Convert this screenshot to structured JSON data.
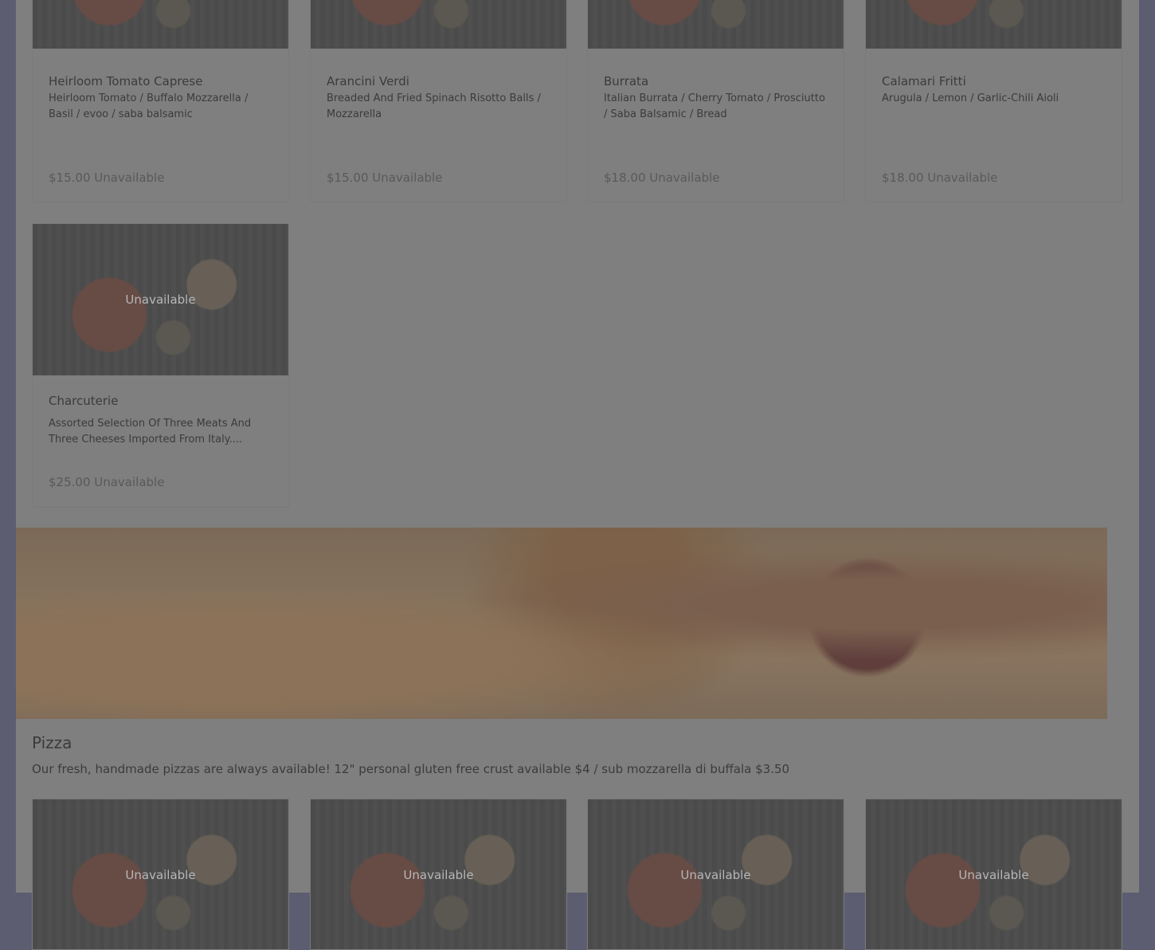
{
  "appetizers": [
    {
      "title": "Heirloom Tomato Caprese",
      "desc": "Heirloom Tomato / Buffalo Mozzarella / Basil / evoo / saba balsamic",
      "price": "$15.00 Unavailable"
    },
    {
      "title": "Arancini Verdi",
      "desc": "Breaded And Fried Spinach Risotto Balls / Mozzarella",
      "price": "$15.00 Unavailable"
    },
    {
      "title": "Burrata",
      "desc": "Italian Burrata / Cherry Tomato / Prosciutto / Saba Balsamic / Bread",
      "price": "$18.00 Unavailable"
    },
    {
      "title": "Calamari Fritti",
      "desc": "Arugula / Lemon / Garlic-Chili Aioli",
      "price": "$18.00 Unavailable"
    },
    {
      "title": "Charcuterie",
      "desc": "Assorted Selection Of Three Meats And Three Cheeses Imported From Italy....",
      "price": "$25.00 Unavailable",
      "image_label": "Unavailable"
    }
  ],
  "pizza_section": {
    "title": "Pizza",
    "desc": "Our fresh, handmade pizzas are always available! 12\" personal gluten free crust available $4 / sub mozzarella di buffala $3.50"
  },
  "pizza_cards": [
    {
      "image_label": "Unavailable"
    },
    {
      "image_label": "Unavailable"
    },
    {
      "image_label": "Unavailable"
    },
    {
      "image_label": "Unavailable"
    }
  ]
}
